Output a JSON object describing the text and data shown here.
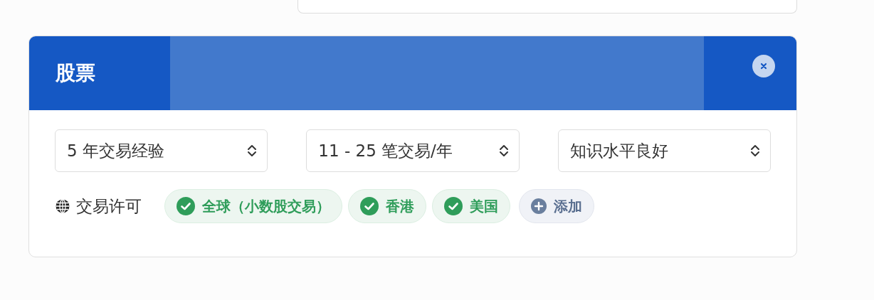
{
  "card": {
    "title": "股票",
    "selects": [
      {
        "value": "5 年交易经验"
      },
      {
        "value": "11 - 25 笔交易/年"
      },
      {
        "value": "知识水平良好"
      }
    ],
    "permissions": {
      "label": "交易许可",
      "chips": [
        {
          "label": "全球（小数股交易）",
          "kind": "region"
        },
        {
          "label": "香港",
          "kind": "region"
        },
        {
          "label": "美国",
          "kind": "region"
        },
        {
          "label": "添加",
          "kind": "add"
        }
      ]
    }
  }
}
